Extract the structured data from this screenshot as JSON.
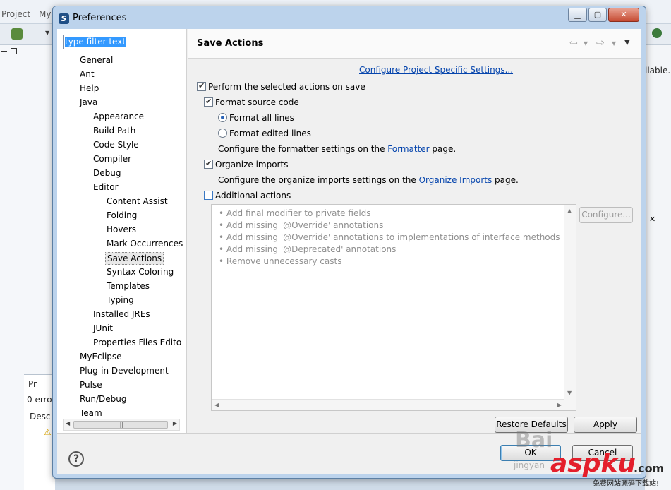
{
  "background": {
    "menu": [
      "Project",
      "My"
    ],
    "right_text": "ilable.",
    "problems_tab": "Pr",
    "errors_text": "0 erro",
    "desc_header": "Desc"
  },
  "dialog": {
    "title": "Preferences",
    "window_buttons": {
      "minimize": "▁",
      "maximize": "▢",
      "close": "✕"
    }
  },
  "filter": {
    "text": "type filter text"
  },
  "tree": [
    {
      "label": "General",
      "level": 0
    },
    {
      "label": "Ant",
      "level": 0
    },
    {
      "label": "Help",
      "level": 0
    },
    {
      "label": "Java",
      "level": 0
    },
    {
      "label": "Appearance",
      "level": 1
    },
    {
      "label": "Build Path",
      "level": 1
    },
    {
      "label": "Code Style",
      "level": 1
    },
    {
      "label": "Compiler",
      "level": 1
    },
    {
      "label": "Debug",
      "level": 1
    },
    {
      "label": "Editor",
      "level": 1
    },
    {
      "label": "Content Assist",
      "level": 2
    },
    {
      "label": "Folding",
      "level": 2
    },
    {
      "label": "Hovers",
      "level": 2
    },
    {
      "label": "Mark Occurrences",
      "level": 2
    },
    {
      "label": "Save Actions",
      "level": 2,
      "selected": true
    },
    {
      "label": "Syntax Coloring",
      "level": 2
    },
    {
      "label": "Templates",
      "level": 2
    },
    {
      "label": "Typing",
      "level": 2
    },
    {
      "label": "Installed JREs",
      "level": 1
    },
    {
      "label": "JUnit",
      "level": 1
    },
    {
      "label": "Properties Files Edito",
      "level": 1
    },
    {
      "label": "MyEclipse",
      "level": 0
    },
    {
      "label": "Plug-in Development",
      "level": 0
    },
    {
      "label": "Pulse",
      "level": 0
    },
    {
      "label": "Run/Debug",
      "level": 0
    },
    {
      "label": "Team",
      "level": 0
    }
  ],
  "page": {
    "title": "Save Actions",
    "config_link": "Configure Project Specific Settings...",
    "perform_save": {
      "label": "Perform the selected actions on save",
      "checked": true
    },
    "format_source": {
      "label": "Format source code",
      "checked": true
    },
    "format_all": {
      "label": "Format all lines",
      "checked": true
    },
    "format_edited": {
      "label": "Format edited lines",
      "checked": false
    },
    "formatter_note": {
      "before": "Configure the formatter settings on the ",
      "link": "Formatter",
      "after": " page."
    },
    "organize_imports": {
      "label": "Organize imports",
      "checked": true
    },
    "organize_note": {
      "before": "Configure the organize imports settings on the ",
      "link": "Organize Imports",
      "after": " page."
    },
    "additional_actions": {
      "label": "Additional actions",
      "checked": false
    },
    "actions": [
      "Add final modifier to private fields",
      "Add missing '@Override' annotations",
      "Add missing '@Override' annotations to implementations of interface methods",
      "Add missing '@Deprecated' annotations",
      "Remove unnecessary casts"
    ],
    "configure_button": "Configure...",
    "restore_defaults": "Restore Defaults",
    "apply": "Apply"
  },
  "footer": {
    "help": "?",
    "ok": "OK",
    "cancel": "Cancel"
  },
  "watermark": {
    "baidu": "Bai",
    "jingyan": "jingyan",
    "site": "aspku",
    "tld": ".com",
    "sub": "免费网站源码下载站!"
  }
}
